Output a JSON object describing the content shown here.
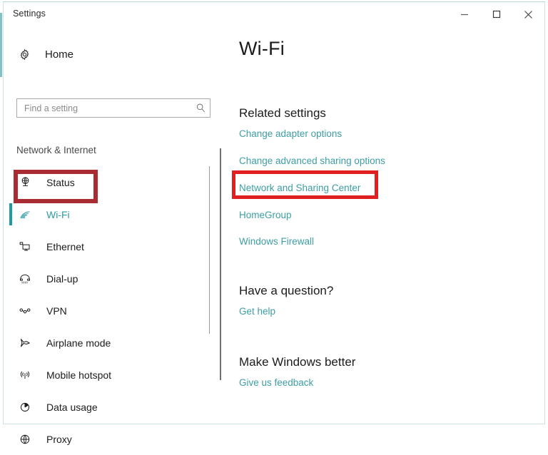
{
  "window": {
    "title": "Settings",
    "controls": [
      {
        "name": "minimize",
        "glyph": "minimize-icon",
        "tooltip": "Minimize"
      },
      {
        "name": "maximize",
        "glyph": "maximize-icon",
        "tooltip": "Maximize"
      },
      {
        "name": "close",
        "glyph": "close-icon",
        "tooltip": "Close"
      }
    ]
  },
  "sidebar": {
    "home_label": "Home",
    "home_icon": "gear-icon",
    "search": {
      "placeholder": "Find a setting",
      "value": "",
      "icon": "search-icon"
    },
    "section_title": "Network & Internet",
    "items": [
      {
        "label": "Status",
        "icon": "status-globe-icon",
        "selected": false
      },
      {
        "label": "Wi-Fi",
        "icon": "wifi-icon",
        "selected": true
      },
      {
        "label": "Ethernet",
        "icon": "ethernet-icon",
        "selected": false
      },
      {
        "label": "Dial-up",
        "icon": "dialup-phone-icon",
        "selected": false
      },
      {
        "label": "VPN",
        "icon": "vpn-icon",
        "selected": false
      },
      {
        "label": "Airplane mode",
        "icon": "airplane-icon",
        "selected": false
      },
      {
        "label": "Mobile hotspot",
        "icon": "hotspot-icon",
        "selected": false
      },
      {
        "label": "Data usage",
        "icon": "pie-chart-icon",
        "selected": false
      },
      {
        "label": "Proxy",
        "icon": "globe-icon",
        "selected": false
      }
    ]
  },
  "content": {
    "page_title": "Wi-Fi",
    "related_settings": {
      "heading": "Related settings",
      "links": [
        "Change adapter options",
        "Change advanced sharing options",
        "Network and Sharing Center",
        "HomeGroup",
        "Windows Firewall"
      ]
    },
    "question": {
      "heading": "Have a question?",
      "links": [
        "Get help"
      ]
    },
    "feedback": {
      "heading": "Make Windows better",
      "links": [
        "Give us feedback"
      ]
    }
  },
  "annotations": [
    {
      "target": "sidebar-item-wi-fi",
      "color": "#a82c31"
    },
    {
      "target": "link-network-and-sharing-center",
      "color": "#e01f20"
    }
  ],
  "colors": {
    "accent_teal": "#1f9aa1",
    "link_teal": "#3d9ea4",
    "annotation_dark_red": "#a82c31",
    "annotation_red": "#e01f20",
    "text": "#1b1b1b"
  }
}
